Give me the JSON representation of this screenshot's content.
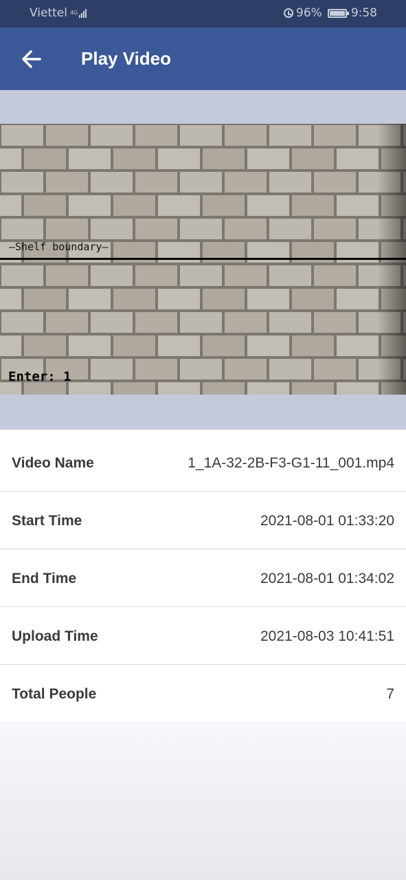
{
  "status_bar": {
    "carrier": "Viettel",
    "network": "4G",
    "battery": "96%",
    "time": "9:58"
  },
  "app_bar": {
    "title": "Play Video",
    "back_icon": "arrow-left-icon"
  },
  "video": {
    "overlay_line_label": "—Shelf boundary—",
    "overlay_counter": "Enter: 1"
  },
  "details": [
    {
      "label": "Video Name",
      "value": "1_1A-32-2B-F3-G1-11_001.mp4"
    },
    {
      "label": "Start Time",
      "value": "2021-08-01 01:33:20"
    },
    {
      "label": "End Time",
      "value": "2021-08-01 01:34:02"
    },
    {
      "label": "Upload Time",
      "value": "2021-08-03 10:41:51"
    },
    {
      "label": "Total People",
      "value": "7"
    }
  ],
  "colors": {
    "status_bar": "#2d3f66",
    "app_bar": "#3b5998",
    "video_background": "#c5c9dc"
  }
}
